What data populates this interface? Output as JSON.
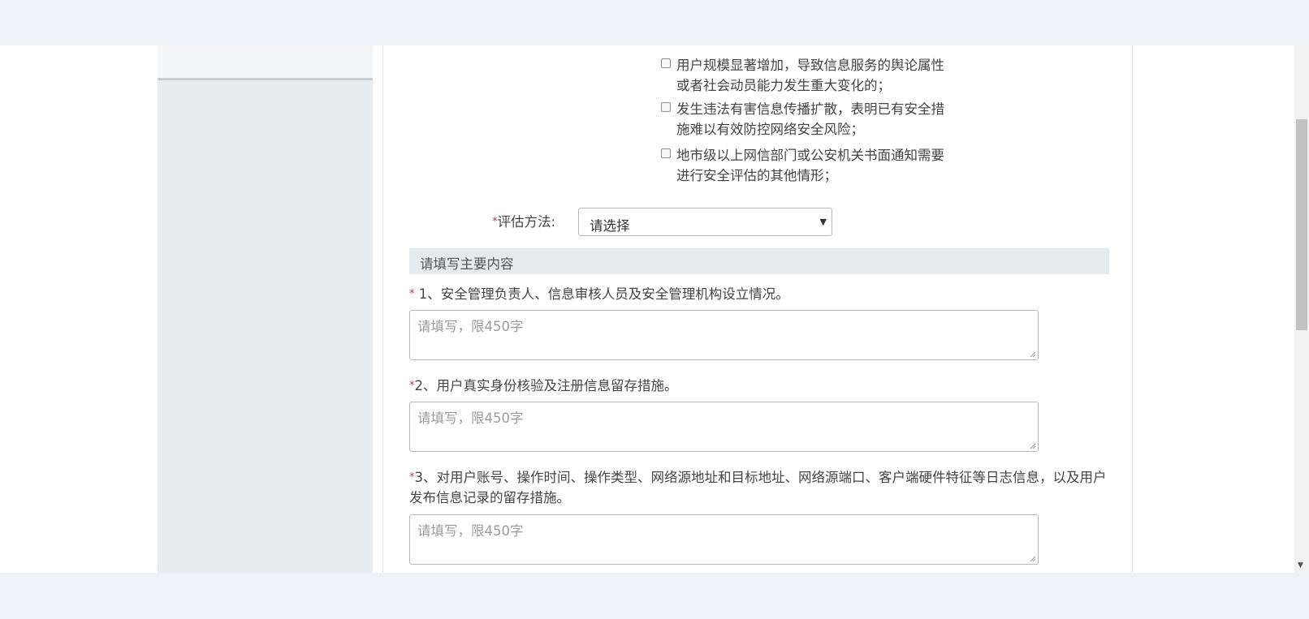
{
  "checkbox_options": [
    "用户规模显著增加，导致信息服务的舆论属性或者社会动员能力发生重大变化的；",
    "发生违法有害信息传播扩散，表明已有安全措施难以有效防控网络安全风险；",
    "地市级以上网信部门或公安机关书面通知需要进行安全评估的其他情形；"
  ],
  "assessment_method": {
    "required_mark": "*",
    "label": "评估方法:",
    "selected": "请选择"
  },
  "section_title": "请填写主要内容",
  "questions": [
    {
      "required_mark": "*",
      "label": " 1、安全管理负责人、信息审核人员及安全管理机构设立情况。",
      "placeholder": "请填写，限450字"
    },
    {
      "required_mark": "*",
      "label": "2、用户真实身份核验及注册信息留存措施。",
      "placeholder": "请填写，限450字"
    },
    {
      "required_mark": "*",
      "label": "3、对用户账号、操作时间、操作类型、网络源地址和目标地址、网络源端口、客户端硬件特征等日志信息，以及用户发布信息记录的留存措施。",
      "placeholder": "请填写，限450字"
    }
  ],
  "icons": {
    "select_arrow": "caret-down-icon",
    "scroll_down": "scroll-down-arrow-icon"
  },
  "colors": {
    "required": "#e0302a",
    "page_bg": "#edf1f8",
    "sidebar_bg": "#e8ecef",
    "section_bg": "#e6eaed"
  }
}
